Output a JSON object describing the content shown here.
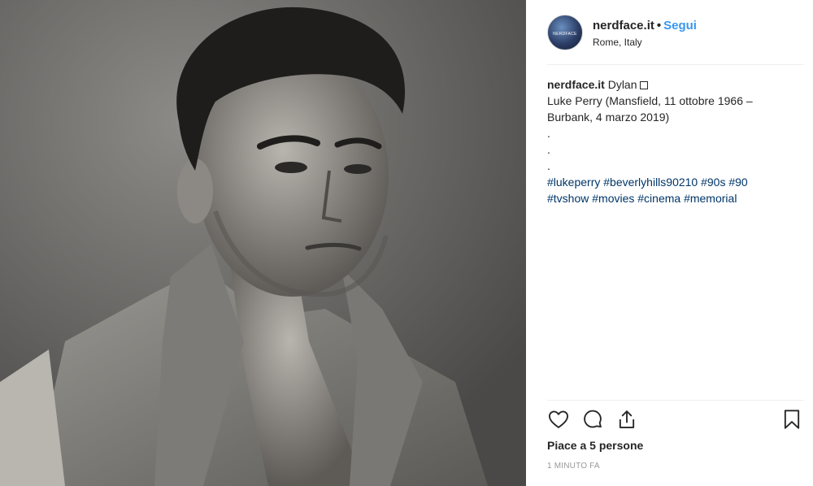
{
  "post": {
    "photo_alt": "Black and white portrait photo",
    "header": {
      "avatar_text": "NERDFACE",
      "username": "nerdface.it",
      "separator": "•",
      "follow_label": "Segui",
      "location": "Rome, Italy"
    },
    "caption": {
      "username": "nerdface.it",
      "title": "Dylan",
      "line1": "Luke Perry (Mansfield, 11 ottobre 1966 –",
      "line2": "Burbank, 4 marzo 2019)",
      "dot1": ".",
      "dot2": ".",
      "dot3": ".",
      "hashtags_line1": "#lukeperry #beverlyhills90210 #90s #90",
      "hashtags_line2": "#tvshow #movies #cinema #memorial"
    },
    "actions": {
      "like_icon": "heart-icon",
      "comment_icon": "comment-icon",
      "share_icon": "share-icon",
      "save_icon": "bookmark-icon"
    },
    "likes_text": "Piace a 5 persone",
    "timestamp": "1 MINUTO FA",
    "colors": {
      "accent": "#3897f0",
      "hashtag": "#003569",
      "text": "#262626",
      "muted": "#999999",
      "divider": "#efefef"
    }
  }
}
